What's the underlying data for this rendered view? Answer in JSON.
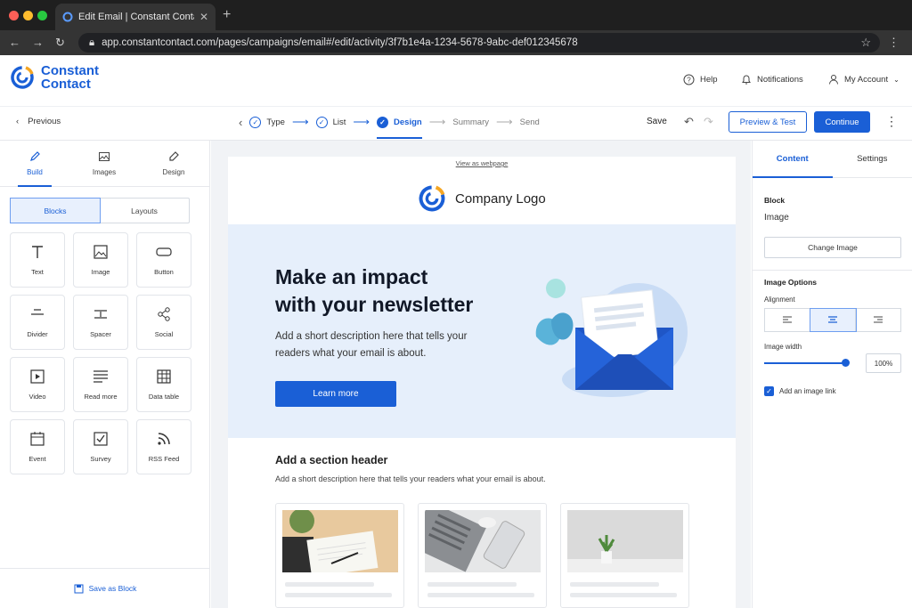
{
  "browser": {
    "tab_title": "Edit Email | Constant Contact",
    "url": "app.constantcontact.com/pages/campaigns/email#/edit/activity/3f7b1e4a-1234-5678-9abc-def012345678"
  },
  "header": {
    "brand_line1": "Constant",
    "brand_line2": "Contact",
    "help": "Help",
    "notifications": "Notifications",
    "account": "My Account"
  },
  "toolbar": {
    "previous": "Previous",
    "steps": [
      "Type",
      "List",
      "Design",
      "Summary",
      "Send"
    ],
    "save": "Save",
    "preview": "Preview & Test",
    "continue": "Continue"
  },
  "left": {
    "tabs": [
      "Build",
      "Images",
      "Design"
    ],
    "segments": [
      "Blocks",
      "Layouts"
    ],
    "blocks": [
      "Text",
      "Image",
      "Button",
      "Divider",
      "Spacer",
      "Social",
      "Video",
      "Read more",
      "Data table",
      "Event",
      "Survey",
      "RSS Feed"
    ],
    "save_block": "Save as Block"
  },
  "email": {
    "view_webpage": "View as webpage",
    "logo_text": "Company Logo",
    "hero_title_1": "Make an impact",
    "hero_title_2": "with your newsletter",
    "hero_desc": "Add a short description here that tells your readers what your email is about.",
    "hero_button": "Learn more",
    "section_title": "Add a section header",
    "section_desc": "Add a short description here that tells your readers what your email is about."
  },
  "right": {
    "tabs": [
      "Content",
      "Settings"
    ],
    "block_label": "Block",
    "block_value": "Image",
    "change_image": "Change Image",
    "options_label": "Image Options",
    "alignment_label": "Alignment",
    "width_label": "Image width",
    "width_value": "100%",
    "link_label": "Add an image link"
  },
  "colors": {
    "brand": "#1a5fd6",
    "hero_bg": "#e6effb"
  }
}
